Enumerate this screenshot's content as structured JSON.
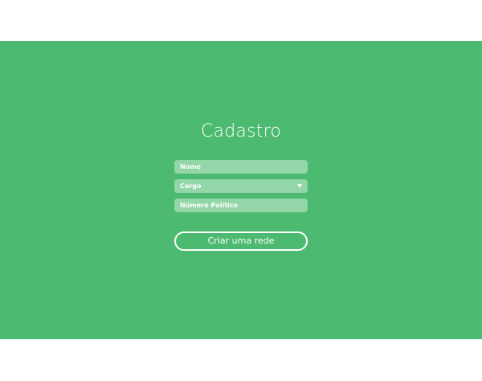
{
  "form": {
    "title": "Cadastro",
    "fields": {
      "nome": {
        "placeholder": "Nome"
      },
      "cargo": {
        "placeholder": "Cargo"
      },
      "numero": {
        "placeholder": "Número Político"
      }
    },
    "submit_label": "Criar uma rede"
  },
  "icons": {
    "cargo_dropdown": "chevron-down-icon"
  },
  "colors": {
    "background": "#4cba71",
    "field_background": "#93d6a8",
    "text": "#ffffff"
  }
}
